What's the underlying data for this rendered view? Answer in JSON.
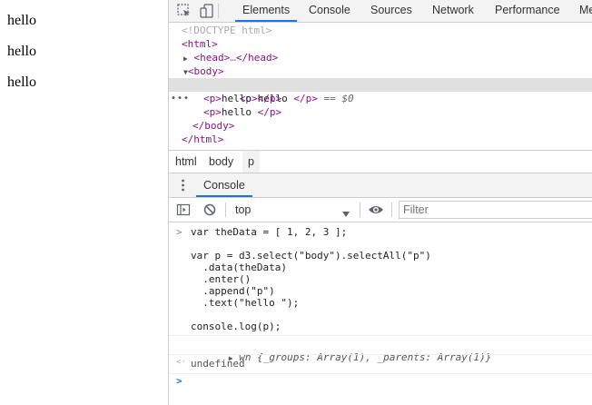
{
  "page": {
    "paragraphs": [
      "hello",
      "hello",
      "hello"
    ]
  },
  "devtools": {
    "tabs": [
      "Elements",
      "Console",
      "Sources",
      "Network",
      "Performance",
      "Me"
    ],
    "active_tab": "Elements",
    "accent_color": "#1a73e8",
    "dom_tree": {
      "doctype": "<!DOCTYPE html>",
      "html_open": "<html>",
      "head_open": "<head>",
      "head_ellipsis": "…",
      "head_close": "</head>",
      "body_open": "<body>",
      "p_open": "<p>",
      "p_text": "hello ",
      "p_close": "</p>",
      "selected_marker": "== $0",
      "dots": "•••",
      "body_close": "</body>",
      "html_close": "</html>"
    },
    "breadcrumbs": [
      "html",
      "body",
      "p"
    ],
    "drawer": {
      "tab": "Console"
    },
    "console_toolbar": {
      "context": "top",
      "filter_placeholder": "Filter"
    },
    "console": {
      "code_lines": [
        "var theData = [ 1, 2, 3 ];",
        "",
        "var p = d3.select(\"body\").selectAll(\"p\")",
        "  .data(theData)",
        "  .enter()",
        "  .append(\"p\")",
        "  .text(\"hello \");",
        "",
        "console.log(p);"
      ],
      "log_output": "wn {_groups: Array(1), _parents: Array(1)}",
      "return_value": "undefined",
      "input_prompt": ">",
      "result_prompt": "<·"
    }
  }
}
